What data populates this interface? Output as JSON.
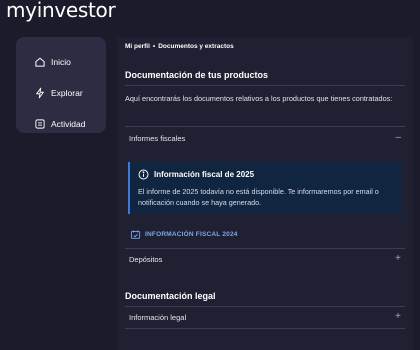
{
  "app": {
    "logo_text": "myinvestor"
  },
  "sidebar": {
    "items": [
      {
        "label": "Inicio",
        "icon": "home-icon"
      },
      {
        "label": "Explorar",
        "icon": "lightning-icon"
      },
      {
        "label": "Actividad",
        "icon": "receipt-icon"
      }
    ]
  },
  "breadcrumb": {
    "items": [
      "Mi perfil",
      "Documentos y extractos"
    ],
    "separator": "•"
  },
  "products": {
    "title": "Documentación de tus productos",
    "description": "Aquí encontrarás los documentos relativos a los productos que tienes contratados:",
    "sections": [
      {
        "label": "Informes fiscales",
        "toggle": "–"
      },
      {
        "label": "Depósitos",
        "toggle": "+"
      }
    ],
    "info": {
      "title": "Información fiscal de 2025",
      "text": "El informe de 2025 todavía no está disponible. Te informaremos por email o notificación cuando se haya generado.",
      "icon": "info-icon"
    },
    "fiscal_link": {
      "label": "INFORMACIÓN FISCAL 2024",
      "icon": "calendar-check-icon"
    }
  },
  "legal": {
    "title": "Documentación legal",
    "sections": [
      {
        "label": "Información legal",
        "toggle": "+"
      }
    ]
  },
  "colors": {
    "background": "#1b1b2b",
    "sidebar": "#2c2d42",
    "panel": "#1f2032",
    "info_bg": "#0f2540",
    "accent": "#7ea6ec"
  }
}
